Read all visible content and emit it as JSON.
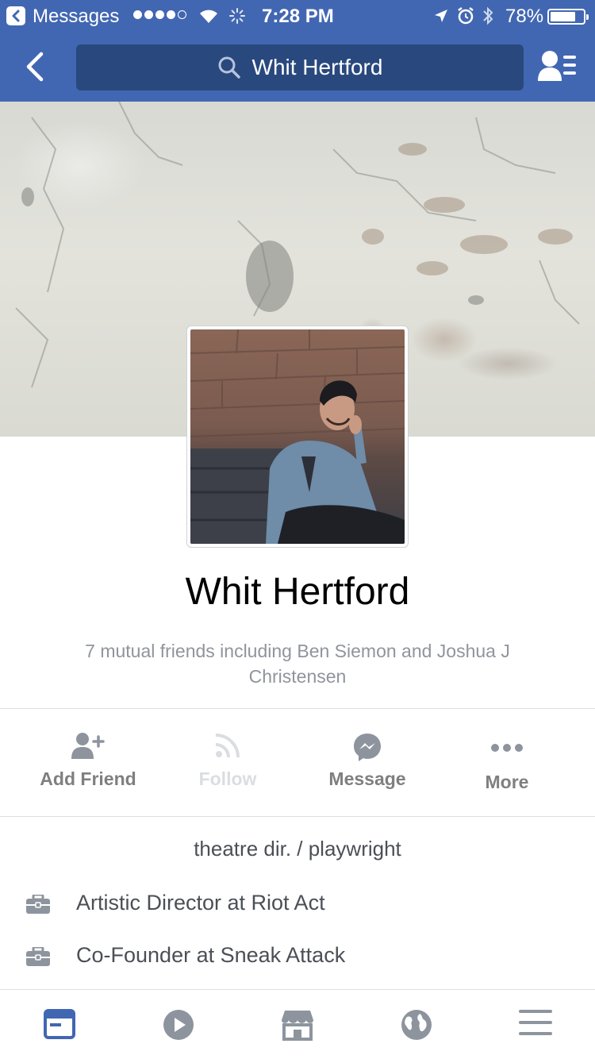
{
  "status_bar": {
    "back_app": "Messages",
    "time": "7:28 PM",
    "battery": "78%",
    "battery_level": 0.78
  },
  "nav": {
    "search_value": "Whit Hertford"
  },
  "profile": {
    "name": "Whit Hertford",
    "mutual_friends": "7 mutual friends including Ben Siemon and Joshua J Christensen"
  },
  "actions": [
    {
      "label": "Add Friend",
      "icon": "add-friend-icon"
    },
    {
      "label": "Follow",
      "icon": "rss-icon",
      "enabled": false
    },
    {
      "label": "Message",
      "icon": "messenger-icon"
    },
    {
      "label": "More",
      "icon": "more-icon"
    }
  ],
  "about": {
    "headline": "theatre dir. / playwright",
    "work": [
      {
        "text": "Artistic Director at Riot Act",
        "icon": "briefcase-icon"
      },
      {
        "text": "Co-Founder at Sneak Attack",
        "icon": "briefcase-icon"
      }
    ]
  },
  "tab_bar": {
    "tabs": [
      "news-feed-icon",
      "video-icon",
      "marketplace-icon",
      "globe-icon",
      "menu-icon"
    ],
    "active_tab": "news-feed-icon"
  },
  "colors": {
    "brand": "#4267b2",
    "search_bg": "#29487d",
    "muted": "#90949c",
    "active_tab": "#4267b2",
    "inactive_tab": "#8d949e"
  }
}
